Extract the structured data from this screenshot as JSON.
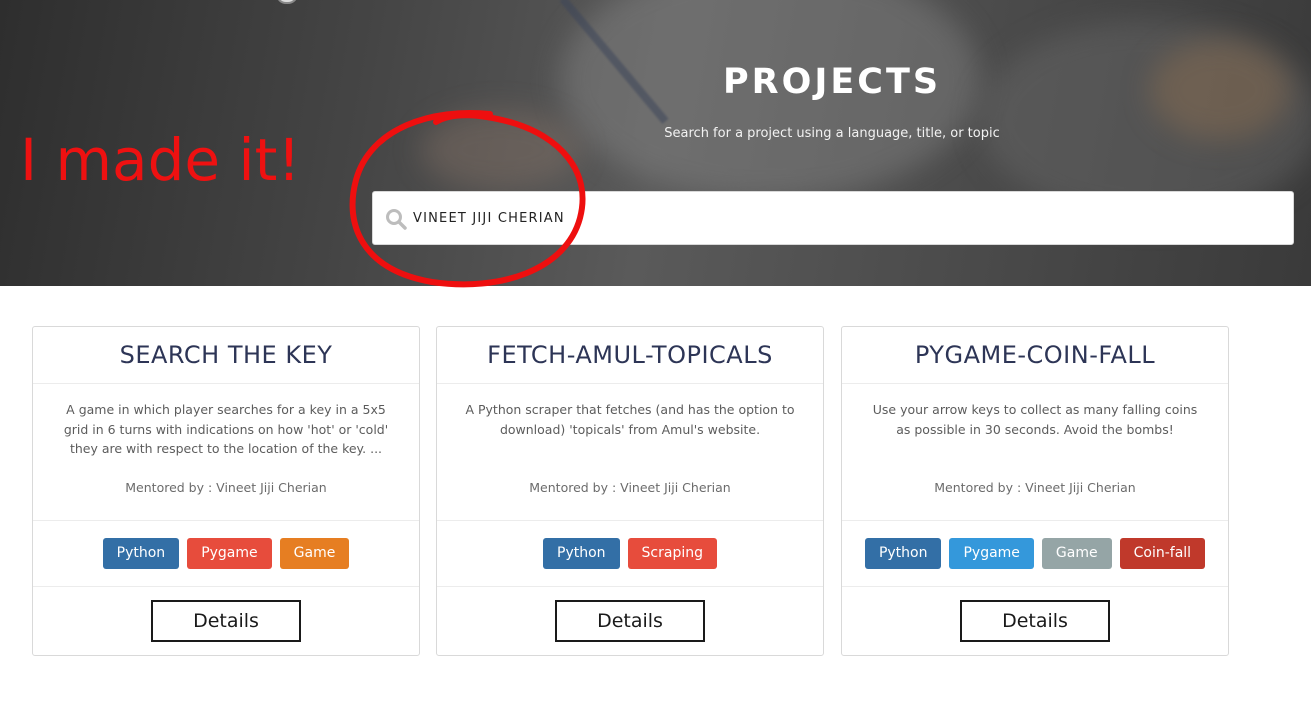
{
  "hero": {
    "title": "PROJECTS",
    "subtitle": "Search for a project using a language, title, or topic",
    "search": {
      "value": "VINEET JIJI CHERIAN",
      "placeholder": ""
    }
  },
  "annotation": {
    "text": "I made it!",
    "color": "#ee1111"
  },
  "colors": {
    "python": "#2e6da4",
    "pygame_red": "#e74c3c",
    "game_orange": "#e67e22",
    "pygame_blue": "#3498db",
    "game_gray": "#95a5a6",
    "coinfall": "#c0392b",
    "scraping": "#e74c3c"
  },
  "cards": [
    {
      "title": "SEARCH THE KEY",
      "description": "A game in which player searches for a key in a 5x5 grid in 6 turns with indications on how 'hot' or 'cold' they are with respect to the location of the key. ...",
      "mentor": "Mentored by : Vineet Jiji Cherian",
      "tags": [
        {
          "label": "Python",
          "color": "#336fa6"
        },
        {
          "label": "Pygame",
          "color": "#e74c3c"
        },
        {
          "label": "Game",
          "color": "#e67e22"
        }
      ],
      "details_label": "Details"
    },
    {
      "title": "FETCH-AMUL-TOPICALS",
      "description": "A Python scraper that fetches (and has the option to download) 'topicals' from Amul's website.",
      "mentor": "Mentored by : Vineet Jiji Cherian",
      "tags": [
        {
          "label": "Python",
          "color": "#336fa6"
        },
        {
          "label": "Scraping",
          "color": "#e74c3c"
        }
      ],
      "details_label": "Details"
    },
    {
      "title": "PYGAME-COIN-FALL",
      "description": "Use your arrow keys to collect as many falling coins as possible in 30 seconds. Avoid the bombs!",
      "mentor": "Mentored by : Vineet Jiji Cherian",
      "tags": [
        {
          "label": "Python",
          "color": "#336fa6"
        },
        {
          "label": "Pygame",
          "color": "#3498db"
        },
        {
          "label": "Game",
          "color": "#95a5a6"
        },
        {
          "label": "Coin-fall",
          "color": "#c0392b"
        }
      ],
      "details_label": "Details"
    }
  ]
}
